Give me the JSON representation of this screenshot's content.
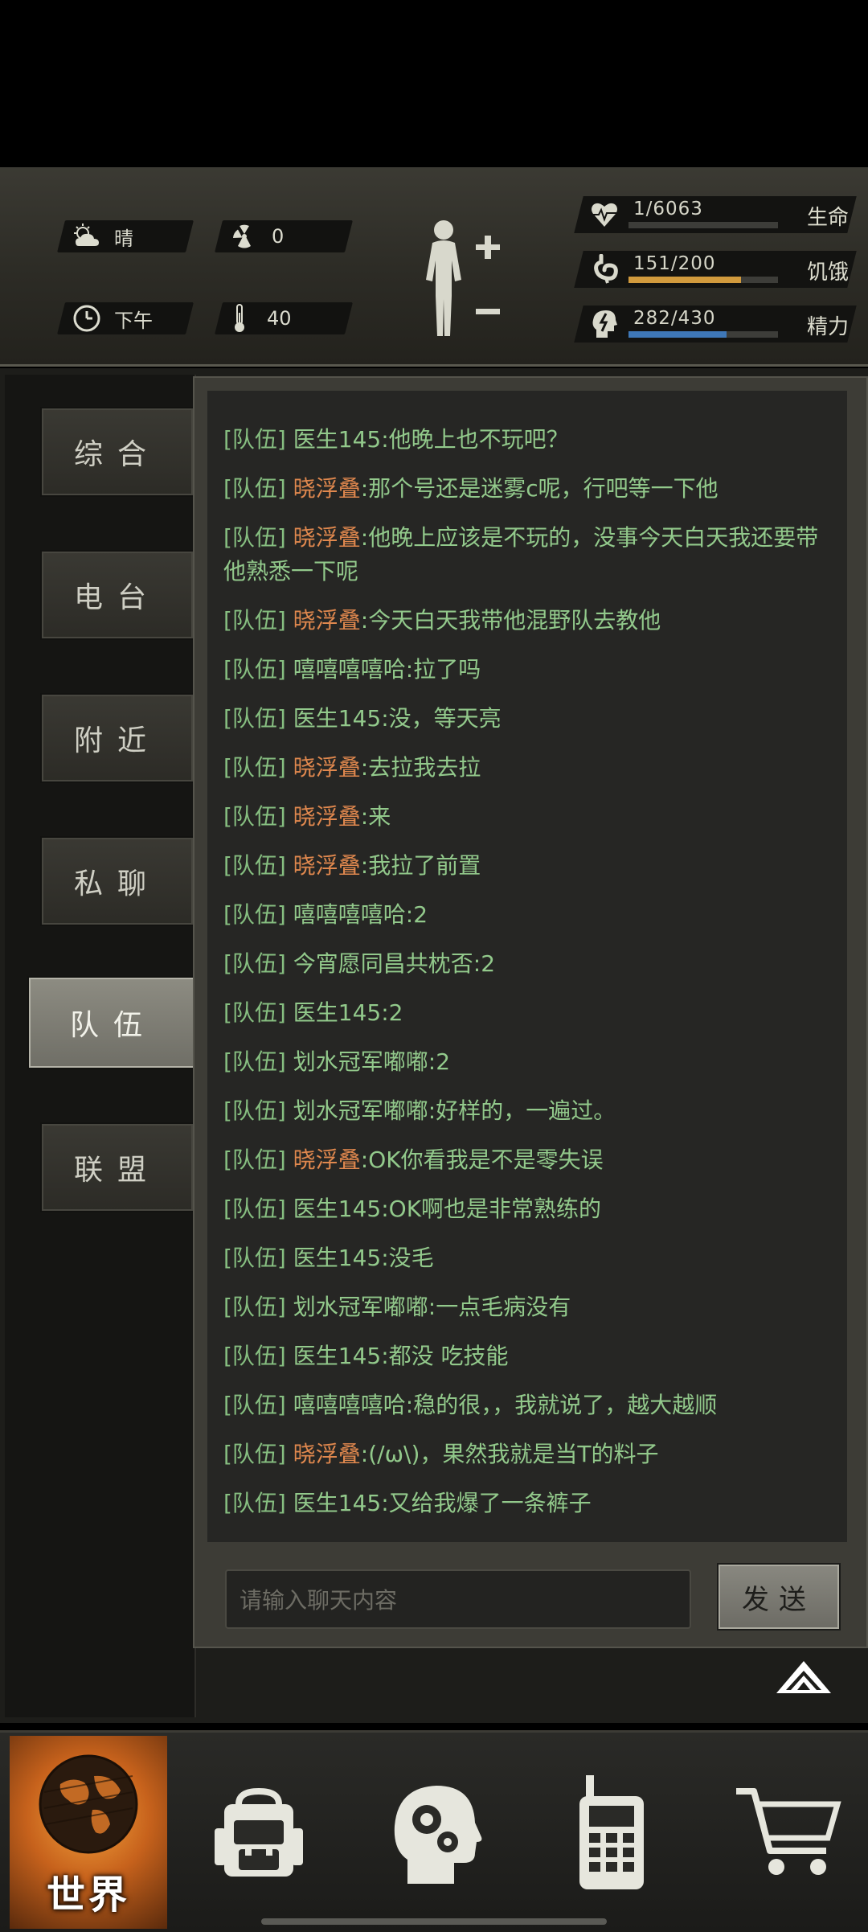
{
  "status": {
    "weather": "晴",
    "radiation": "0",
    "time_of_day": "下午",
    "temperature": "40",
    "health": {
      "value": "1/6063",
      "label": "生命",
      "fraction": 0.0002,
      "color": "#8a8a84"
    },
    "hunger": {
      "value": "151/200",
      "label": "饥饿",
      "fraction": 0.755,
      "color": "#d19a3d"
    },
    "energy": {
      "value": "282/430",
      "label": "精力",
      "fraction": 0.656,
      "color": "#3f78b8"
    }
  },
  "tabs": [
    {
      "label": "综合",
      "active": false
    },
    {
      "label": "电台",
      "active": false
    },
    {
      "label": "附近",
      "active": false
    },
    {
      "label": "私聊",
      "active": false
    },
    {
      "label": "队伍",
      "active": true
    },
    {
      "label": "联盟",
      "active": false
    }
  ],
  "chat": {
    "messages": [
      {
        "tag": "[队伍]",
        "name": "医生145",
        "text": ":他晚上也不玩吧？",
        "name_color": "green"
      },
      {
        "tag": "[队伍]",
        "name": "晓浮叠",
        "text": ":那个号还是迷雾c呢，行吧等一下他",
        "name_color": "orange"
      },
      {
        "tag": "[队伍]",
        "name": "晓浮叠",
        "text": ":他晚上应该是不玩的，没事今天白天我还要带他熟悉一下呢",
        "name_color": "orange"
      },
      {
        "tag": "[队伍]",
        "name": "晓浮叠",
        "text": ":今天白天我带他混野队去教他",
        "name_color": "orange"
      },
      {
        "tag": "[队伍]",
        "name": "嘻嘻嘻嘻哈",
        "text": ":拉了吗",
        "name_color": "green"
      },
      {
        "tag": "[队伍]",
        "name": "医生145",
        "text": ":没，等天亮",
        "name_color": "green"
      },
      {
        "tag": "[队伍]",
        "name": "晓浮叠",
        "text": ":去拉我去拉",
        "name_color": "orange"
      },
      {
        "tag": "[队伍]",
        "name": "晓浮叠",
        "text": ":来",
        "name_color": "orange"
      },
      {
        "tag": "[队伍]",
        "name": "晓浮叠",
        "text": ":我拉了前置",
        "name_color": "orange"
      },
      {
        "tag": "[队伍]",
        "name": "嘻嘻嘻嘻哈",
        "text": ":2",
        "name_color": "green"
      },
      {
        "tag": "[队伍]",
        "name": "今宵愿同昌共枕否",
        "text": ":2",
        "name_color": "green"
      },
      {
        "tag": "[队伍]",
        "name": "医生145",
        "text": ":2",
        "name_color": "green"
      },
      {
        "tag": "[队伍]",
        "name": "划水冠军嘟嘟",
        "text": ":2",
        "name_color": "green"
      },
      {
        "tag": "[队伍]",
        "name": "划水冠军嘟嘟",
        "text": ":好样的，一遍过。",
        "name_color": "green"
      },
      {
        "tag": "[队伍]",
        "name": "晓浮叠",
        "text": ":OK你看我是不是零失误",
        "name_color": "orange"
      },
      {
        "tag": "[队伍]",
        "name": "医生145",
        "text": ":OK啊也是非常熟练的",
        "name_color": "green"
      },
      {
        "tag": "[队伍]",
        "name": "医生145",
        "text": ":没毛",
        "name_color": "green"
      },
      {
        "tag": "[队伍]",
        "name": "划水冠军嘟嘟",
        "text": ":一点毛病没有",
        "name_color": "green"
      },
      {
        "tag": "[队伍]",
        "name": "医生145",
        "text": ":都没 吃技能",
        "name_color": "green"
      },
      {
        "tag": "[队伍]",
        "name": "嘻嘻嘻嘻哈",
        "text": ":稳的很，，我就说了，越大越顺",
        "name_color": "green"
      },
      {
        "tag": "[队伍]",
        "name": "晓浮叠",
        "text": ":(/ω\\)，果然我就是当T的料子",
        "name_color": "orange"
      },
      {
        "tag": "[队伍]",
        "name": "医生145",
        "text": ":又给我爆了一条裤子",
        "name_color": "green"
      }
    ],
    "input_placeholder": "请输入聊天内容",
    "send_label": "发送"
  },
  "bottom_nav": {
    "world_label": "世界"
  },
  "icons": {
    "weather": "sun-cloud-icon",
    "radiation": "radiation-icon",
    "time": "clock-icon",
    "temperature": "thermometer-icon",
    "health": "heartbeat-icon",
    "hunger": "stomach-icon",
    "energy": "head-lightning-icon",
    "body": "body-figure-icon"
  }
}
